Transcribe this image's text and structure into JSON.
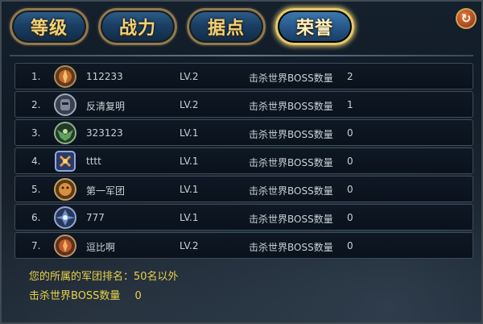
{
  "tabs": [
    {
      "label": "等级",
      "active": false
    },
    {
      "label": "战力",
      "active": false
    },
    {
      "label": "据点",
      "active": false
    },
    {
      "label": "荣誉",
      "active": true
    }
  ],
  "refresh_icon": "refresh-icon",
  "rows": [
    {
      "rank": "1.",
      "emblem": "warrior-emblem-icon",
      "name": "112233",
      "level": "LV.2",
      "kill_label": "击杀世界BOSS数量",
      "kill_value": "2"
    },
    {
      "rank": "2.",
      "emblem": "knight-emblem-icon",
      "name": "反清复明",
      "level": "LV.2",
      "kill_label": "击杀世界BOSS数量",
      "kill_value": "1"
    },
    {
      "rank": "3.",
      "emblem": "dragon-emblem-icon",
      "name": "323123",
      "level": "LV.1",
      "kill_label": "击杀世界BOSS数量",
      "kill_value": "0"
    },
    {
      "rank": "4.",
      "emblem": "rune-emblem-icon",
      "name": "tttt",
      "level": "LV.1",
      "kill_label": "击杀世界BOSS数量",
      "kill_value": "0"
    },
    {
      "rank": "5.",
      "emblem": "lion-emblem-icon",
      "name": "第一军团",
      "level": "LV.1",
      "kill_label": "击杀世界BOSS数量",
      "kill_value": "0"
    },
    {
      "rank": "6.",
      "emblem": "phoenix-emblem-icon",
      "name": "777",
      "level": "LV.1",
      "kill_label": "击杀世界BOSS数量",
      "kill_value": "0"
    },
    {
      "rank": "7.",
      "emblem": "warrior-emblem-icon",
      "name": "逗比啊",
      "level": "LV.2",
      "kill_label": "击杀世界BOSS数量",
      "kill_value": "0"
    }
  ],
  "footer": {
    "rank_text": "您的所属的军团排名：50名以外",
    "kill_label": "击杀世界BOSS数量",
    "kill_value": "0"
  },
  "colors": {
    "tab_gold": "#f1d27a",
    "footer_text": "#e8d24a",
    "row_text": "#c9d1d6"
  }
}
